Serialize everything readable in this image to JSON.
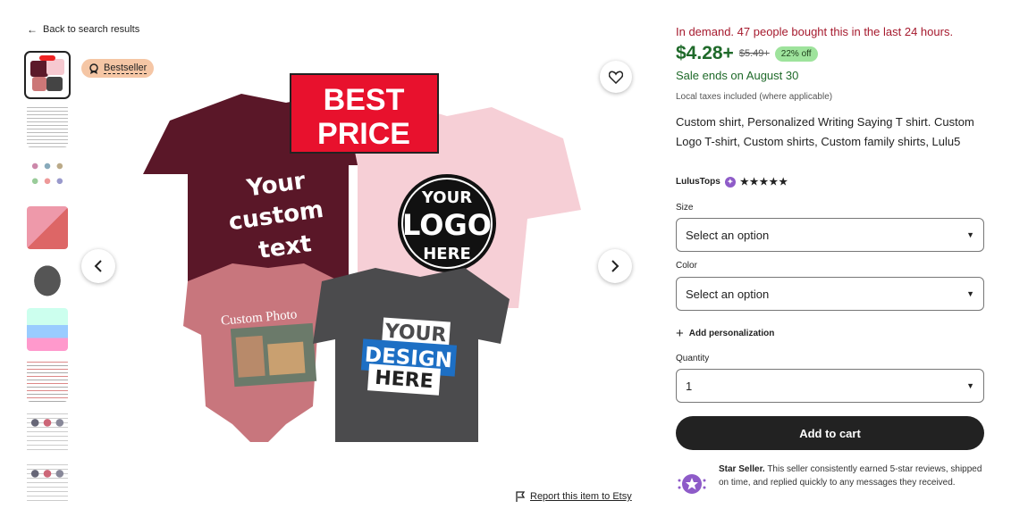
{
  "nav": {
    "back_label": "Back to search results"
  },
  "gallery": {
    "badge_label": "Bestseller",
    "report_label": "Report this item to Etsy",
    "image_texts": {
      "best_price": "BEST PRICE",
      "custom_text": "Your custom text",
      "logo": "YOUR LOGO HERE",
      "custom_photo": "Custom Photo",
      "design": "YOUR DESIGN HERE"
    }
  },
  "listing": {
    "demand": "In demand. 47 people bought this in the last 24 hours.",
    "price": "$4.28+",
    "old_price": "$5.49+",
    "discount": "22% off",
    "sale_ends": "Sale ends on August 30",
    "tax_note": "Local taxes included (where applicable)",
    "title": "Custom shirt, Personalized Writing Saying T shirt. Custom Logo T-shirt, Custom shirts, Custom family shirts, Lulu5",
    "seller_name": "LulusTops",
    "stars": "★★★★★"
  },
  "form": {
    "size_label": "Size",
    "size_value": "Select an option",
    "color_label": "Color",
    "color_value": "Select an option",
    "personalization_label": "Add personalization",
    "quantity_label": "Quantity",
    "quantity_value": "1",
    "add_to_cart": "Add to cart"
  },
  "star_seller": {
    "heading": "Star Seller.",
    "text": "This seller consistently earned 5-star reviews, shipped on time, and replied quickly to any messages they received."
  },
  "colors": {
    "demand_red": "#a61a2e",
    "price_green": "#1f6a2a",
    "discount_bg": "#9ee39c",
    "badge_bg": "#f5c6a5",
    "star_seller_purple": "#8e5bc8"
  }
}
